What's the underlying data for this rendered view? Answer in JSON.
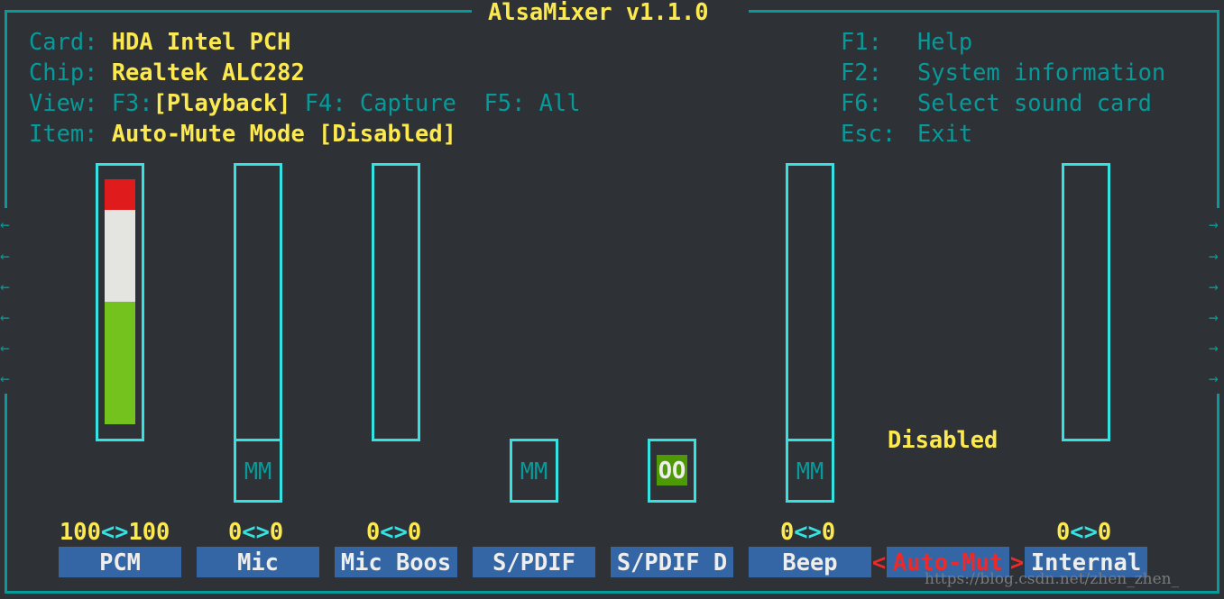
{
  "title": "AlsaMixer v1.1.0",
  "info": {
    "card_label": "Card:",
    "card": "HDA Intel PCH",
    "chip_label": "Chip:",
    "chip": "Realtek ALC282",
    "view_label": "View:",
    "view_f3": "F3:",
    "view_playback": "[Playback]",
    "view_f4": "F4: Capture",
    "view_f5": "F5: All",
    "item_label": "Item:",
    "item": "Auto-Mute Mode [Disabled]"
  },
  "keys": [
    {
      "key": "F1:",
      "action": "Help"
    },
    {
      "key": "F2:",
      "action": "System information"
    },
    {
      "key": "F6:",
      "action": "Select sound card"
    },
    {
      "key": "Esc:",
      "action": "Exit"
    }
  ],
  "controls": [
    {
      "name": "PCM",
      "left": "100",
      "right": "100",
      "level_percent": 100
    },
    {
      "name": "Mic",
      "left": "0",
      "right": "0",
      "mute": "MM",
      "level_percent": 0
    },
    {
      "name": "Mic Boos",
      "left": "0",
      "right": "0",
      "level_percent": 0
    },
    {
      "name": "S/PDIF",
      "mute": "MM"
    },
    {
      "name": "S/PDIF D",
      "mute": "OO"
    },
    {
      "name": "Beep",
      "left": "0",
      "right": "0",
      "mute": "MM",
      "level_percent": 0
    },
    {
      "name": "Auto-Mut",
      "enum_value": "Disabled",
      "selected": true
    },
    {
      "name": "Internal",
      "left": "0",
      "right": "0",
      "level_percent": 0
    }
  ],
  "sep": "<>",
  "sel_left": "<",
  "sel_right": ">",
  "scroll_left": "←",
  "scroll_right": "→",
  "watermark": "https://blog.csdn.net/zhen_zhen_",
  "colors": {
    "background": "#2e3236",
    "frame": "#069a9a",
    "highlight": "#fce94f",
    "bar_border": "#34e2e2",
    "label_bg": "#3465a4",
    "selected": "#ef2929",
    "green": "#73d216",
    "white": "#e4e4e0",
    "red": "#e01b1b"
  }
}
